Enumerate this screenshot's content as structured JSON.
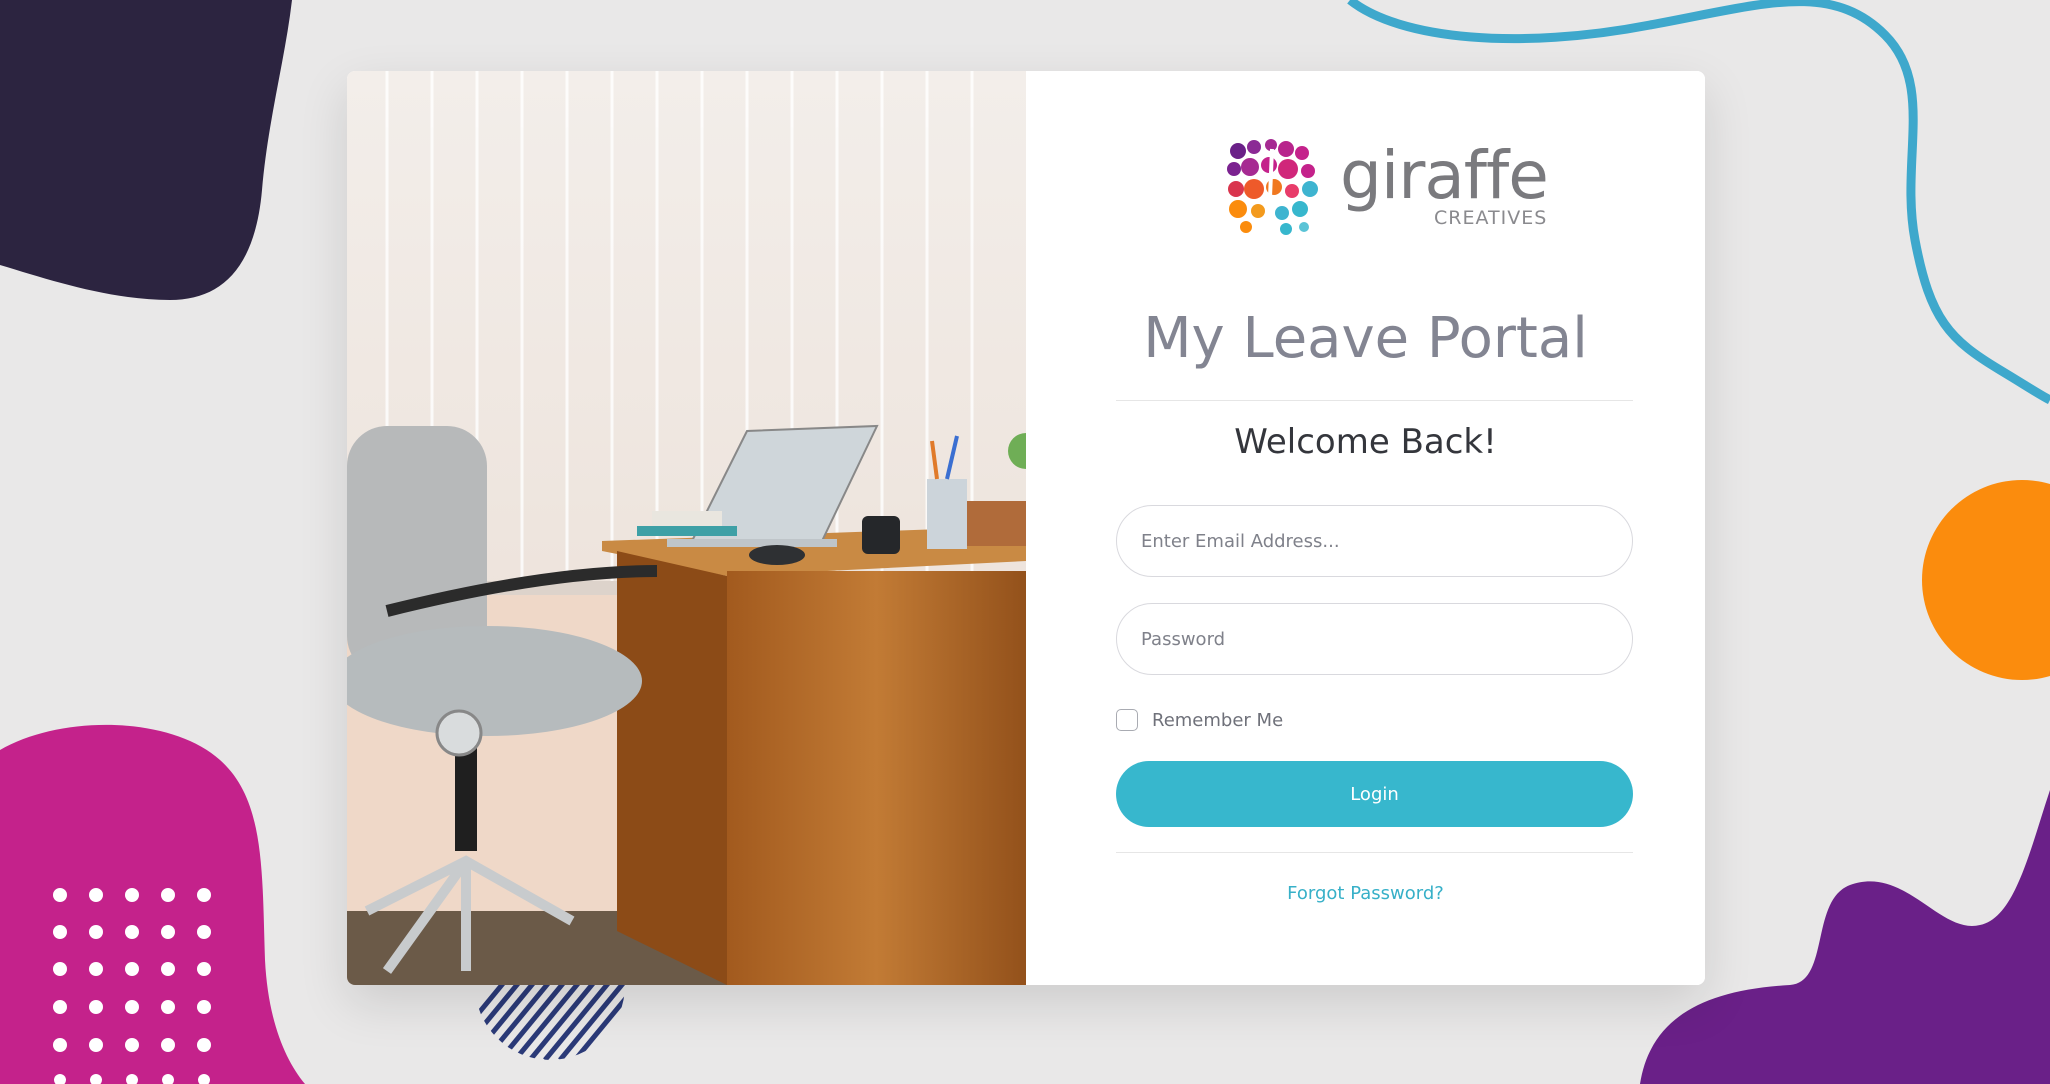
{
  "brand": {
    "name": "giraffe",
    "tagline": "CREATIVES",
    "logo_icon": "giraffe-dots-logo"
  },
  "login": {
    "title": "My Leave Portal",
    "welcome": "Welcome Back!",
    "email_placeholder": "Enter Email Address...",
    "password_placeholder": "Password",
    "remember_label": "Remember Me",
    "remember_checked": false,
    "login_label": "Login",
    "forgot_label": "Forgot Password?"
  },
  "colors": {
    "accent": "#37b7cd",
    "title": "#838592",
    "navy_blob": "#2c2440",
    "magenta_blob": "#c4228b",
    "purple_blob": "#6a2088",
    "orange_circle": "#fb8c0d",
    "blue_line": "#3ea8cc"
  }
}
